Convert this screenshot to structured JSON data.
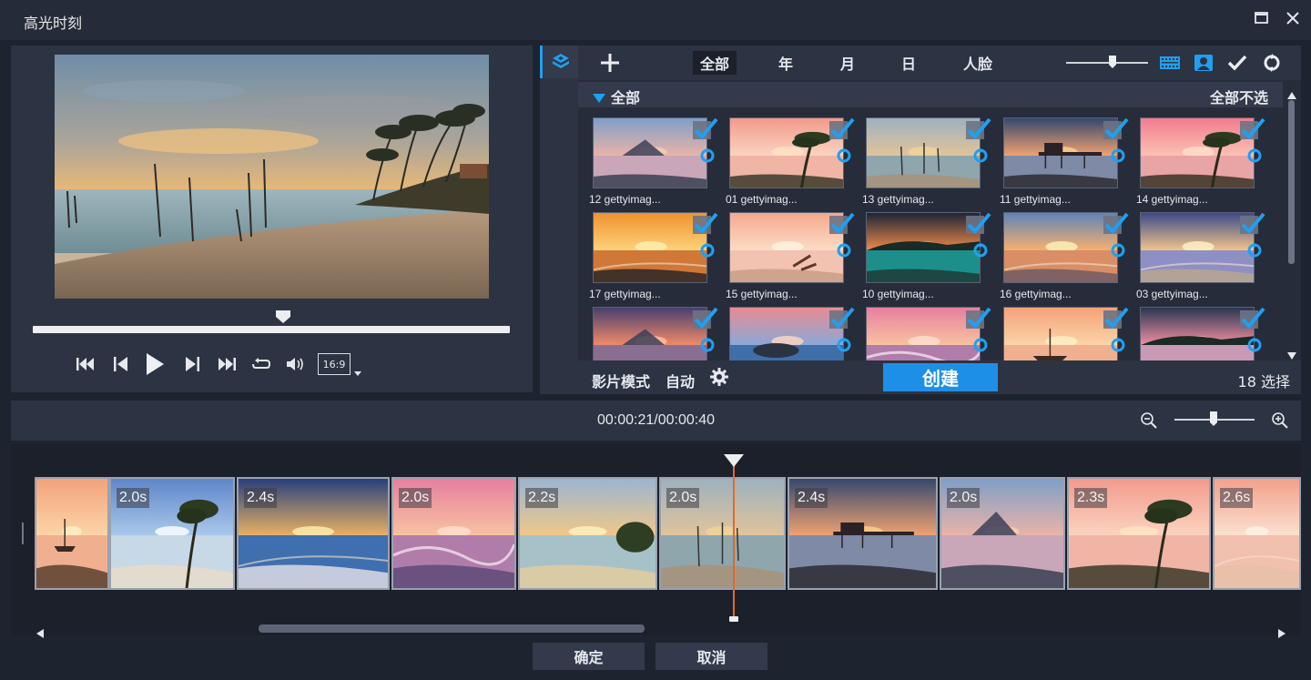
{
  "window": {
    "title": "高光时刻",
    "icons": {
      "maximize": "maximize-icon",
      "close": "close-icon"
    }
  },
  "preview": {
    "transport_icons": [
      "skip-to-start-icon",
      "step-back-icon",
      "play-icon",
      "step-forward-icon",
      "skip-to-end-icon",
      "repeat-icon",
      "volume-icon"
    ],
    "aspect_ratio": "16:9",
    "scrub_progress": 0.52
  },
  "library": {
    "filter_tabs": [
      "全部",
      "年",
      "月",
      "日",
      "人脸"
    ],
    "active_filter": "全部",
    "toolbar_icons": [
      "filmstrip-view-icon",
      "face-view-icon",
      "checkmark-icon",
      "refresh-icon"
    ],
    "group_title": "全部",
    "deselect_all": "全部不选",
    "thumbnails": [
      {
        "label": "12 gettyimag...",
        "scene": "volcano-lake",
        "checked": true
      },
      {
        "label": "01 gettyimag...",
        "scene": "palm-pink",
        "checked": true
      },
      {
        "label": "13 gettyimag...",
        "scene": "poles-sea",
        "checked": true
      },
      {
        "label": "11 gettyimag...",
        "scene": "pier-sunset",
        "checked": true
      },
      {
        "label": "14 gettyimag...",
        "scene": "palm-pink2",
        "checked": true
      },
      {
        "label": "17 gettyimag...",
        "scene": "orange-shore",
        "checked": true
      },
      {
        "label": "15 gettyimag...",
        "scene": "driftwood",
        "checked": true
      },
      {
        "label": "10 gettyimag...",
        "scene": "lagoon",
        "checked": true
      },
      {
        "label": "16 gettyimag...",
        "scene": "sunset-glow",
        "checked": true
      },
      {
        "label": "03 gettyimag...",
        "scene": "purple-beach",
        "checked": true
      },
      {
        "label": "",
        "scene": "rock-dusk",
        "checked": true
      },
      {
        "label": "",
        "scene": "blue-rocks",
        "checked": true
      },
      {
        "label": "",
        "scene": "wave-pink",
        "checked": true
      },
      {
        "label": "",
        "scene": "boat-sunset",
        "checked": true
      },
      {
        "label": "",
        "scene": "cliff-shore",
        "checked": true
      }
    ]
  },
  "footer": {
    "film_mode_label": "影片模式",
    "film_mode_value": "自动",
    "create_label": "创建",
    "selected_count": "18 选择"
  },
  "timeline": {
    "timecode": "00:00:21/00:00:40",
    "zoom_level": 0.45,
    "clips": [
      {
        "duration": "",
        "scene": "boat-sunset"
      },
      {
        "duration": "2.0s",
        "scene": "palm-blue"
      },
      {
        "duration": "2.4s",
        "scene": "blue-sky-sun"
      },
      {
        "duration": "2.0s",
        "scene": "wave-pink"
      },
      {
        "duration": "2.2s",
        "scene": "beach-tree"
      },
      {
        "duration": "2.0s",
        "scene": "poles-sea"
      },
      {
        "duration": "2.4s",
        "scene": "pier-sunset"
      },
      {
        "duration": "2.0s",
        "scene": "volcano-lake"
      },
      {
        "duration": "2.3s",
        "scene": "palm-pink"
      },
      {
        "duration": "2.6s",
        "scene": "pink-shore"
      }
    ]
  },
  "dialog": {
    "ok_label": "确定",
    "cancel_label": "取消"
  }
}
